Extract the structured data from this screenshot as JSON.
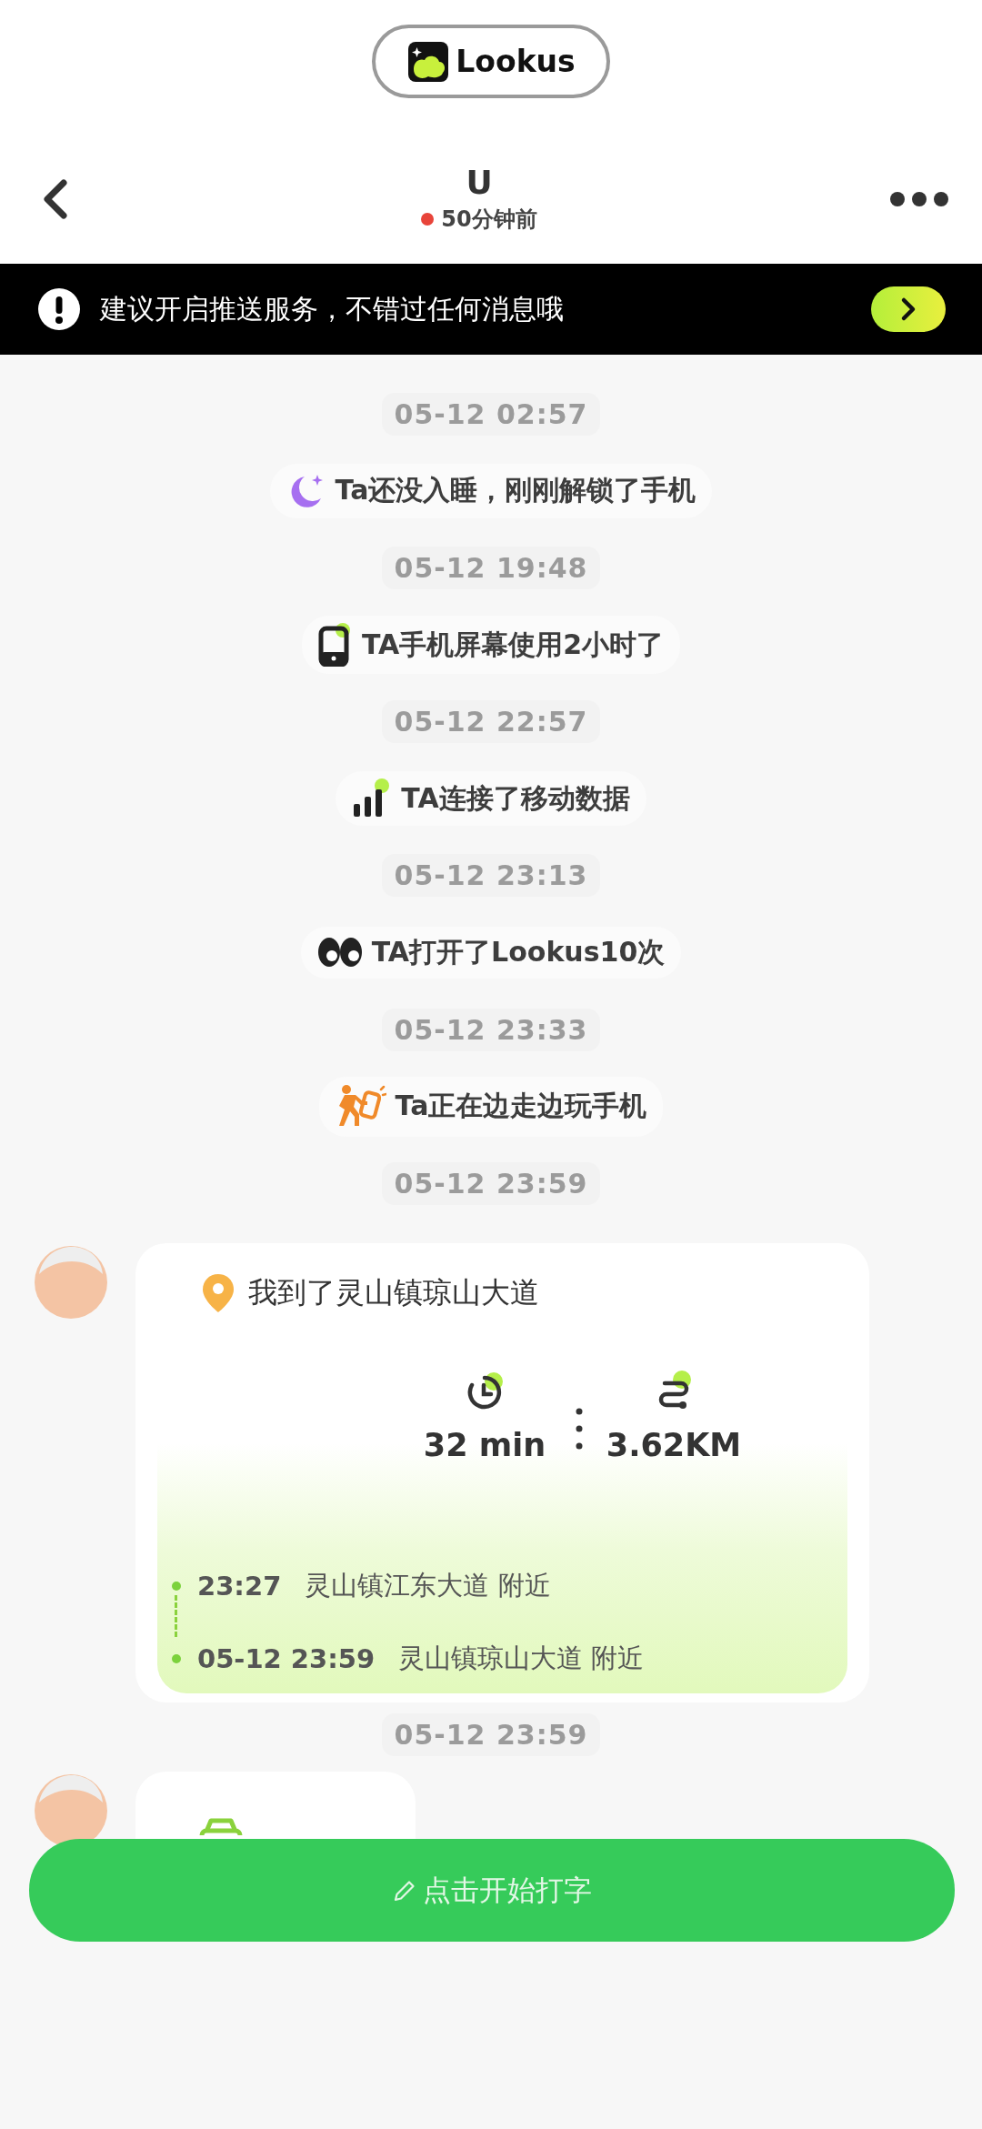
{
  "app_badge": {
    "label": "Lookus"
  },
  "header": {
    "title": "U",
    "status": "50分钟前"
  },
  "notice": {
    "text": "建议开启推送服务，不错过任何消息哦"
  },
  "feed": [
    {
      "kind": "time",
      "text": "05-12 02:57"
    },
    {
      "kind": "sleep",
      "text": "Ta还没入睡，刚刚解锁了手机"
    },
    {
      "kind": "time",
      "text": "05-12 19:48"
    },
    {
      "kind": "screen",
      "text": "TA手机屏幕使用2小时了"
    },
    {
      "kind": "time",
      "text": "05-12 22:57"
    },
    {
      "kind": "network",
      "text": "TA连接了移动数据"
    },
    {
      "kind": "time",
      "text": "05-12 23:13"
    },
    {
      "kind": "opens",
      "text": "TA打开了Lookus10次"
    },
    {
      "kind": "time",
      "text": "05-12 23:33"
    },
    {
      "kind": "walking",
      "text": "Ta正在边走边玩手机"
    },
    {
      "kind": "time",
      "text": "05-12 23:59"
    },
    {
      "kind": "trip",
      "title": "我到了灵山镇琼山大道",
      "duration": "32 min",
      "distance": "3.62KM",
      "stops": [
        {
          "time": "23:27",
          "place": "灵山镇江东大道 附近"
        },
        {
          "time": "05-12 23:59",
          "place": "灵山镇琼山大道 附近"
        }
      ]
    },
    {
      "kind": "time",
      "text": "05-12 23:59"
    },
    {
      "kind": "message"
    }
  ],
  "composer": {
    "label": "点击开始打字"
  }
}
